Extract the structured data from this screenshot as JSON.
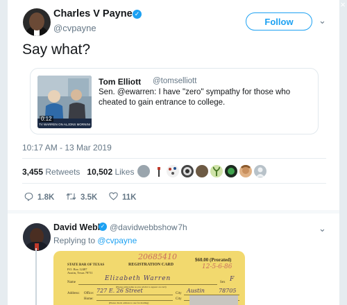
{
  "main_tweet": {
    "author_name": "Charles V Payne",
    "author_handle": "@cvpayne",
    "follow_label": "Follow",
    "text": "Say what?",
    "timestamp": "10:17 AM - 13 Mar 2019",
    "retweets_count": "3,455",
    "retweets_label": "Retweets",
    "likes_count": "10,502",
    "likes_label": "Likes",
    "actions": {
      "replies": "1.8K",
      "retweets": "3.5K",
      "likes": "11K"
    }
  },
  "quoted_tweet": {
    "author_name": "Tom Elliott",
    "author_handle": "@tomselliott",
    "text": "Sen. @ewarren: I have \"zero\" sympathy for those who cheated to gain entrance to college.",
    "video_duration": "0:12",
    "video_caption": "TV WARREN ON ALJONS MORNING JOE"
  },
  "reply_tweet": {
    "author_name": "David Webb",
    "author_handle": "@davidwebbshow",
    "time": "· 7h",
    "replying_to_prefix": "Replying to",
    "replying_to_handle": "@cvpayne",
    "document": {
      "stamp_number": "20685410",
      "amount": "$60.00 (Prorated)",
      "date_note": "12-5-6-86",
      "org_line1": "STATE BAR OF TEXAS",
      "org_line2": "P.O. Box 12487",
      "org_line3": "Austin, Texas 78711",
      "card_title": "REGISTRATION CARD",
      "name_label": "Name",
      "name_value": "Elizabeth  Warren",
      "sex_label": "Sex",
      "sex_value": "F",
      "name_hint": "(Please print name as you wish it to appear on card)",
      "address_label": "Address:",
      "office_label": "Office:",
      "office_value": "727 E. 26 Street",
      "city_label": "City",
      "city_value": "Austin",
      "zip_value": "78705",
      "home_label": "Home:",
      "home_hint": "(Please check address to use for mailing)"
    }
  },
  "colors": {
    "accent": "#1da1f2",
    "muted": "#657786",
    "background": "#e6ecf0"
  }
}
